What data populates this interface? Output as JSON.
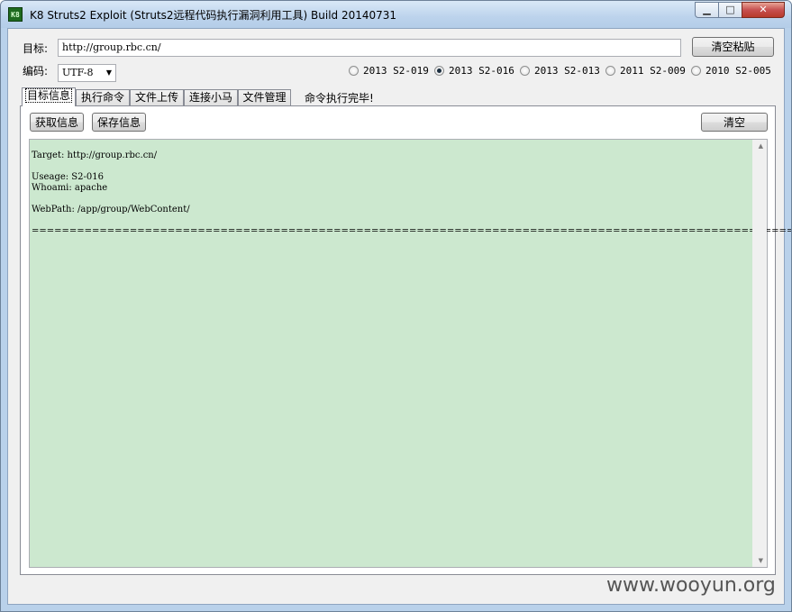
{
  "window": {
    "title": "K8 Struts2 Exploit (Struts2远程代码执行漏洞利用工具) Build 20140731",
    "icon_text": "K8",
    "min_glyph": "▁",
    "max_glyph": "□",
    "close_glyph": "✕"
  },
  "target": {
    "label": "目标:",
    "value": "http://group.rbc.cn/",
    "clear_paste_label": "清空粘贴"
  },
  "encoding": {
    "label": "编码:",
    "selected": "UTF-8"
  },
  "vulns": [
    {
      "label": "2013 S2-019",
      "checked": false
    },
    {
      "label": "2013 S2-016",
      "checked": true
    },
    {
      "label": "2013 S2-013",
      "checked": false
    },
    {
      "label": "2011 S2-009",
      "checked": false
    },
    {
      "label": "2010 S2-005",
      "checked": false
    }
  ],
  "tabs": [
    {
      "label": "目标信息",
      "active": true
    },
    {
      "label": "执行命令",
      "active": false
    },
    {
      "label": "文件上传",
      "active": false
    },
    {
      "label": "连接小马",
      "active": false
    },
    {
      "label": "文件管理",
      "active": false
    }
  ],
  "status": "命令执行完毕!",
  "panel": {
    "get_info_label": "获取信息",
    "save_info_label": "保存信息",
    "clear_label": "清空"
  },
  "output": {
    "lines": [
      "Target: http://group.rbc.cn/",
      "",
      "Useage: S2-016",
      "Whoami: apache",
      "",
      "WebPath: /app/group/WebContent/",
      "",
      "======================================================================================================================="
    ]
  },
  "watermark": "www.wooyun.org"
}
